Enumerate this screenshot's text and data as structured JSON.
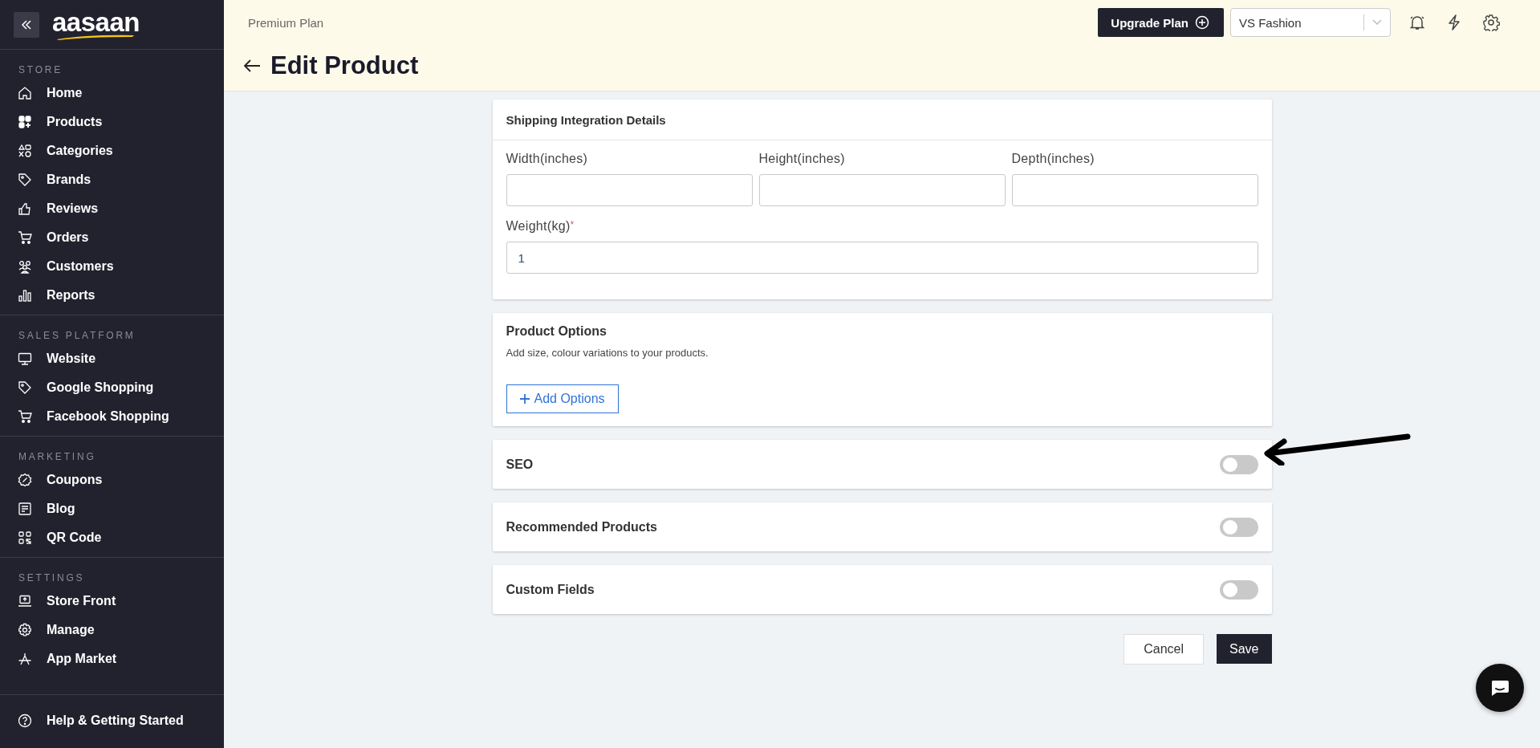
{
  "sidebar": {
    "logo": "aasaan",
    "sections": [
      {
        "label": "STORE",
        "items": [
          {
            "label": "Home"
          },
          {
            "label": "Products"
          },
          {
            "label": "Categories"
          },
          {
            "label": "Brands"
          },
          {
            "label": "Reviews"
          },
          {
            "label": "Orders"
          },
          {
            "label": "Customers"
          },
          {
            "label": "Reports"
          }
        ]
      },
      {
        "label": "SALES PLATFORM",
        "items": [
          {
            "label": "Website"
          },
          {
            "label": "Google Shopping"
          },
          {
            "label": "Facebook Shopping"
          }
        ]
      },
      {
        "label": "MARKETING",
        "items": [
          {
            "label": "Coupons"
          },
          {
            "label": "Blog"
          },
          {
            "label": "QR Code"
          }
        ]
      },
      {
        "label": "SETTINGS",
        "items": [
          {
            "label": "Store Front"
          },
          {
            "label": "Manage"
          },
          {
            "label": "App Market"
          }
        ]
      }
    ],
    "footer_item": {
      "label": "Help & Getting Started"
    }
  },
  "header": {
    "plan": "Premium Plan",
    "upgrade_button": "Upgrade Plan",
    "store_select": "VS Fashion",
    "page_title": "Edit Product"
  },
  "shipping": {
    "title": "Shipping Integration Details",
    "fields": [
      {
        "label": "Width(inches)",
        "required": false
      },
      {
        "label": "Height(inches)",
        "required": false
      },
      {
        "label": "Depth(inches)",
        "required": false
      },
      {
        "label": "Weight(kg)",
        "value": "1",
        "required": true
      }
    ],
    "required_mark": "*"
  },
  "product_options": {
    "title": "Product Options",
    "description": "Add size, colour variations to your products.",
    "button": "Add Options"
  },
  "toggle_sections": [
    {
      "label": "SEO",
      "on": false
    },
    {
      "label": "Recommended Products",
      "on": false
    },
    {
      "label": "Custom Fields",
      "on": false
    }
  ],
  "actions": {
    "cancel": "Cancel",
    "save": "Save"
  }
}
